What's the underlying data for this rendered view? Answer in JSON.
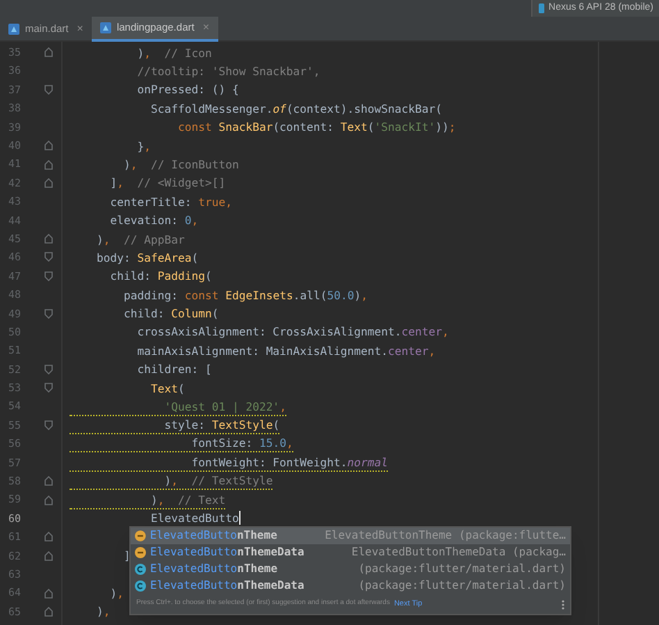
{
  "device_selector": {
    "label": "Nexus 6 API 28 (mobile)"
  },
  "tabs": [
    {
      "label": "main.dart",
      "selected": false,
      "close": "×"
    },
    {
      "label": "landingpage.dart",
      "selected": true,
      "close": "×"
    }
  ],
  "lines": [
    {
      "number": "35",
      "fold_open": false,
      "fold_close": true,
      "tokens": [
        {
          "text": "          )",
          "kind": "plain"
        },
        {
          "text": ",",
          "kind": "keyword"
        },
        {
          "text": "  // Icon",
          "kind": "comment"
        }
      ]
    },
    {
      "number": "36",
      "fold_open": false,
      "fold_close": false,
      "tokens": [
        {
          "text": "          //tooltip: 'Show Snackbar',",
          "kind": "comment"
        }
      ]
    },
    {
      "number": "37",
      "fold_open": true,
      "fold_close": false,
      "tokens": [
        {
          "text": "          onPressed: () {",
          "kind": "plain"
        }
      ]
    },
    {
      "number": "38",
      "fold_open": false,
      "fold_close": false,
      "tokens": [
        {
          "text": "            ScaffoldMessenger.",
          "kind": "plain"
        },
        {
          "text": "of",
          "kind": "static_call"
        },
        {
          "text": "(context).showSnackBar(",
          "kind": "plain"
        }
      ]
    },
    {
      "number": "39",
      "fold_open": false,
      "fold_close": false,
      "tokens": [
        {
          "text": "                const ",
          "kind": "keyword"
        },
        {
          "text": "SnackBar",
          "kind": "type"
        },
        {
          "text": "(content: ",
          "kind": "plain"
        },
        {
          "text": "Text",
          "kind": "type"
        },
        {
          "text": "(",
          "kind": "plain"
        },
        {
          "text": "'SnackIt'",
          "kind": "string"
        },
        {
          "text": "))",
          "kind": "plain"
        },
        {
          "text": ";",
          "kind": "keyword"
        }
      ]
    },
    {
      "number": "40",
      "fold_open": false,
      "fold_close": true,
      "tokens": [
        {
          "text": "          }",
          "kind": "plain"
        },
        {
          "text": ",",
          "kind": "keyword"
        }
      ]
    },
    {
      "number": "41",
      "fold_open": false,
      "fold_close": true,
      "tokens": [
        {
          "text": "        )",
          "kind": "plain"
        },
        {
          "text": ",",
          "kind": "keyword"
        },
        {
          "text": "  // IconButton",
          "kind": "comment"
        }
      ]
    },
    {
      "number": "42",
      "fold_open": false,
      "fold_close": true,
      "tokens": [
        {
          "text": "      ]",
          "kind": "plain"
        },
        {
          "text": ",",
          "kind": "keyword"
        },
        {
          "text": "  // <Widget>[]",
          "kind": "comment"
        }
      ]
    },
    {
      "number": "43",
      "fold_open": false,
      "fold_close": false,
      "tokens": [
        {
          "text": "      centerTitle: ",
          "kind": "plain"
        },
        {
          "text": "true",
          "kind": "keyword"
        },
        {
          "text": ",",
          "kind": "keyword"
        }
      ]
    },
    {
      "number": "44",
      "fold_open": false,
      "fold_close": false,
      "tokens": [
        {
          "text": "      elevation: ",
          "kind": "plain"
        },
        {
          "text": "0",
          "kind": "number"
        },
        {
          "text": ",",
          "kind": "keyword"
        }
      ]
    },
    {
      "number": "45",
      "fold_open": false,
      "fold_close": true,
      "tokens": [
        {
          "text": "    )",
          "kind": "plain"
        },
        {
          "text": ",",
          "kind": "keyword"
        },
        {
          "text": "  // AppBar",
          "kind": "comment"
        }
      ]
    },
    {
      "number": "46",
      "fold_open": true,
      "fold_close": false,
      "tokens": [
        {
          "text": "    body: ",
          "kind": "plain"
        },
        {
          "text": "SafeArea",
          "kind": "type"
        },
        {
          "text": "(",
          "kind": "plain"
        }
      ]
    },
    {
      "number": "47",
      "fold_open": true,
      "fold_close": false,
      "tokens": [
        {
          "text": "      child: ",
          "kind": "plain"
        },
        {
          "text": "Padding",
          "kind": "type"
        },
        {
          "text": "(",
          "kind": "plain"
        }
      ]
    },
    {
      "number": "48",
      "fold_open": false,
      "fold_close": false,
      "tokens": [
        {
          "text": "        padding: ",
          "kind": "plain"
        },
        {
          "text": "const ",
          "kind": "keyword"
        },
        {
          "text": "EdgeInsets",
          "kind": "type"
        },
        {
          "text": ".all(",
          "kind": "plain"
        },
        {
          "text": "50.0",
          "kind": "number"
        },
        {
          "text": ")",
          "kind": "plain"
        },
        {
          "text": ",",
          "kind": "keyword"
        }
      ]
    },
    {
      "number": "49",
      "fold_open": true,
      "fold_close": false,
      "tokens": [
        {
          "text": "        child: ",
          "kind": "plain"
        },
        {
          "text": "Column",
          "kind": "type"
        },
        {
          "text": "(",
          "kind": "plain"
        }
      ]
    },
    {
      "number": "50",
      "fold_open": false,
      "fold_close": false,
      "tokens": [
        {
          "text": "          crossAxisAlignment: CrossAxisAlignment.",
          "kind": "plain"
        },
        {
          "text": "center",
          "kind": "field"
        },
        {
          "text": ",",
          "kind": "keyword"
        }
      ]
    },
    {
      "number": "51",
      "fold_open": false,
      "fold_close": false,
      "tokens": [
        {
          "text": "          mainAxisAlignment: MainAxisAlignment.",
          "kind": "plain"
        },
        {
          "text": "center",
          "kind": "field"
        },
        {
          "text": ",",
          "kind": "keyword"
        }
      ]
    },
    {
      "number": "52",
      "fold_open": true,
      "fold_close": false,
      "tokens": [
        {
          "text": "          children: [",
          "kind": "plain"
        }
      ]
    },
    {
      "number": "53",
      "fold_open": true,
      "fold_close": false,
      "tokens": [
        {
          "text": "            Text",
          "kind": "type"
        },
        {
          "text": "(",
          "kind": "plain"
        }
      ]
    },
    {
      "number": "54",
      "fold_open": false,
      "fold_close": false,
      "warning": true,
      "tokens": [
        {
          "text": "              'Quest 01 | 2022'",
          "kind": "string"
        },
        {
          "text": ",",
          "kind": "keyword"
        }
      ]
    },
    {
      "number": "55",
      "fold_open": true,
      "fold_close": false,
      "warning": true,
      "tokens": [
        {
          "text": "              style: ",
          "kind": "plain"
        },
        {
          "text": "TextStyle",
          "kind": "type"
        },
        {
          "text": "(",
          "kind": "plain"
        }
      ]
    },
    {
      "number": "56",
      "fold_open": false,
      "fold_close": false,
      "warning": true,
      "tokens": [
        {
          "text": "                  fontSize: ",
          "kind": "plain"
        },
        {
          "text": "15.0",
          "kind": "number"
        },
        {
          "text": ",",
          "kind": "keyword"
        }
      ]
    },
    {
      "number": "57",
      "fold_open": false,
      "fold_close": false,
      "warning": true,
      "tokens": [
        {
          "text": "                  fontWeight: FontWeight.",
          "kind": "plain"
        },
        {
          "text": "normal",
          "kind": "static_field"
        }
      ]
    },
    {
      "number": "58",
      "fold_open": false,
      "fold_close": true,
      "warning": true,
      "tokens": [
        {
          "text": "              )",
          "kind": "plain"
        },
        {
          "text": ",",
          "kind": "keyword"
        },
        {
          "text": "  // TextStyle",
          "kind": "comment"
        }
      ]
    },
    {
      "number": "59",
      "fold_open": false,
      "fold_close": true,
      "warning": true,
      "tokens": [
        {
          "text": "            )",
          "kind": "plain"
        },
        {
          "text": ",",
          "kind": "keyword"
        },
        {
          "text": "  // Text",
          "kind": "comment"
        }
      ]
    },
    {
      "number": "60",
      "fold_open": false,
      "fold_close": false,
      "current": true,
      "tokens": [
        {
          "text": "            ElevatedButto",
          "kind": "plain"
        }
      ]
    },
    {
      "number": "61",
      "fold_open": false,
      "fold_close": true
    },
    {
      "number": "62",
      "fold_open": false,
      "fold_close": true,
      "tokens": [
        {
          "text": "        ]",
          "kind": "plain"
        }
      ]
    },
    {
      "number": "63",
      "fold_open": false,
      "fold_close": false
    },
    {
      "number": "64",
      "fold_open": false,
      "fold_close": true,
      "tokens": [
        {
          "text": "      )",
          "kind": "plain"
        },
        {
          "text": ",",
          "kind": "keyword"
        }
      ]
    },
    {
      "number": "65",
      "fold_open": false,
      "fold_close": true,
      "tokens": [
        {
          "text": "    )",
          "kind": "plain"
        },
        {
          "text": ",",
          "kind": "keyword"
        }
      ]
    }
  ],
  "completion": {
    "items": [
      {
        "kind": "method",
        "match": "ElevatedButto",
        "rest": "nTheme",
        "detail": "ElevatedButtonTheme (package:flutte…",
        "selected": true
      },
      {
        "kind": "method",
        "match": "ElevatedButto",
        "rest": "nThemeData",
        "detail": "ElevatedButtonThemeData (packag…",
        "selected": false
      },
      {
        "kind": "class",
        "match": "ElevatedButto",
        "rest": "nTheme",
        "detail": "(package:flutter/material.dart)",
        "selected": false
      },
      {
        "kind": "class",
        "match": "ElevatedButto",
        "rest": "nThemeData",
        "detail": "(package:flutter/material.dart)",
        "selected": false
      }
    ],
    "hint": "Press Ctrl+. to choose the selected (or first) suggestion and insert a dot afterwards",
    "hint_link": "Next Tip"
  }
}
